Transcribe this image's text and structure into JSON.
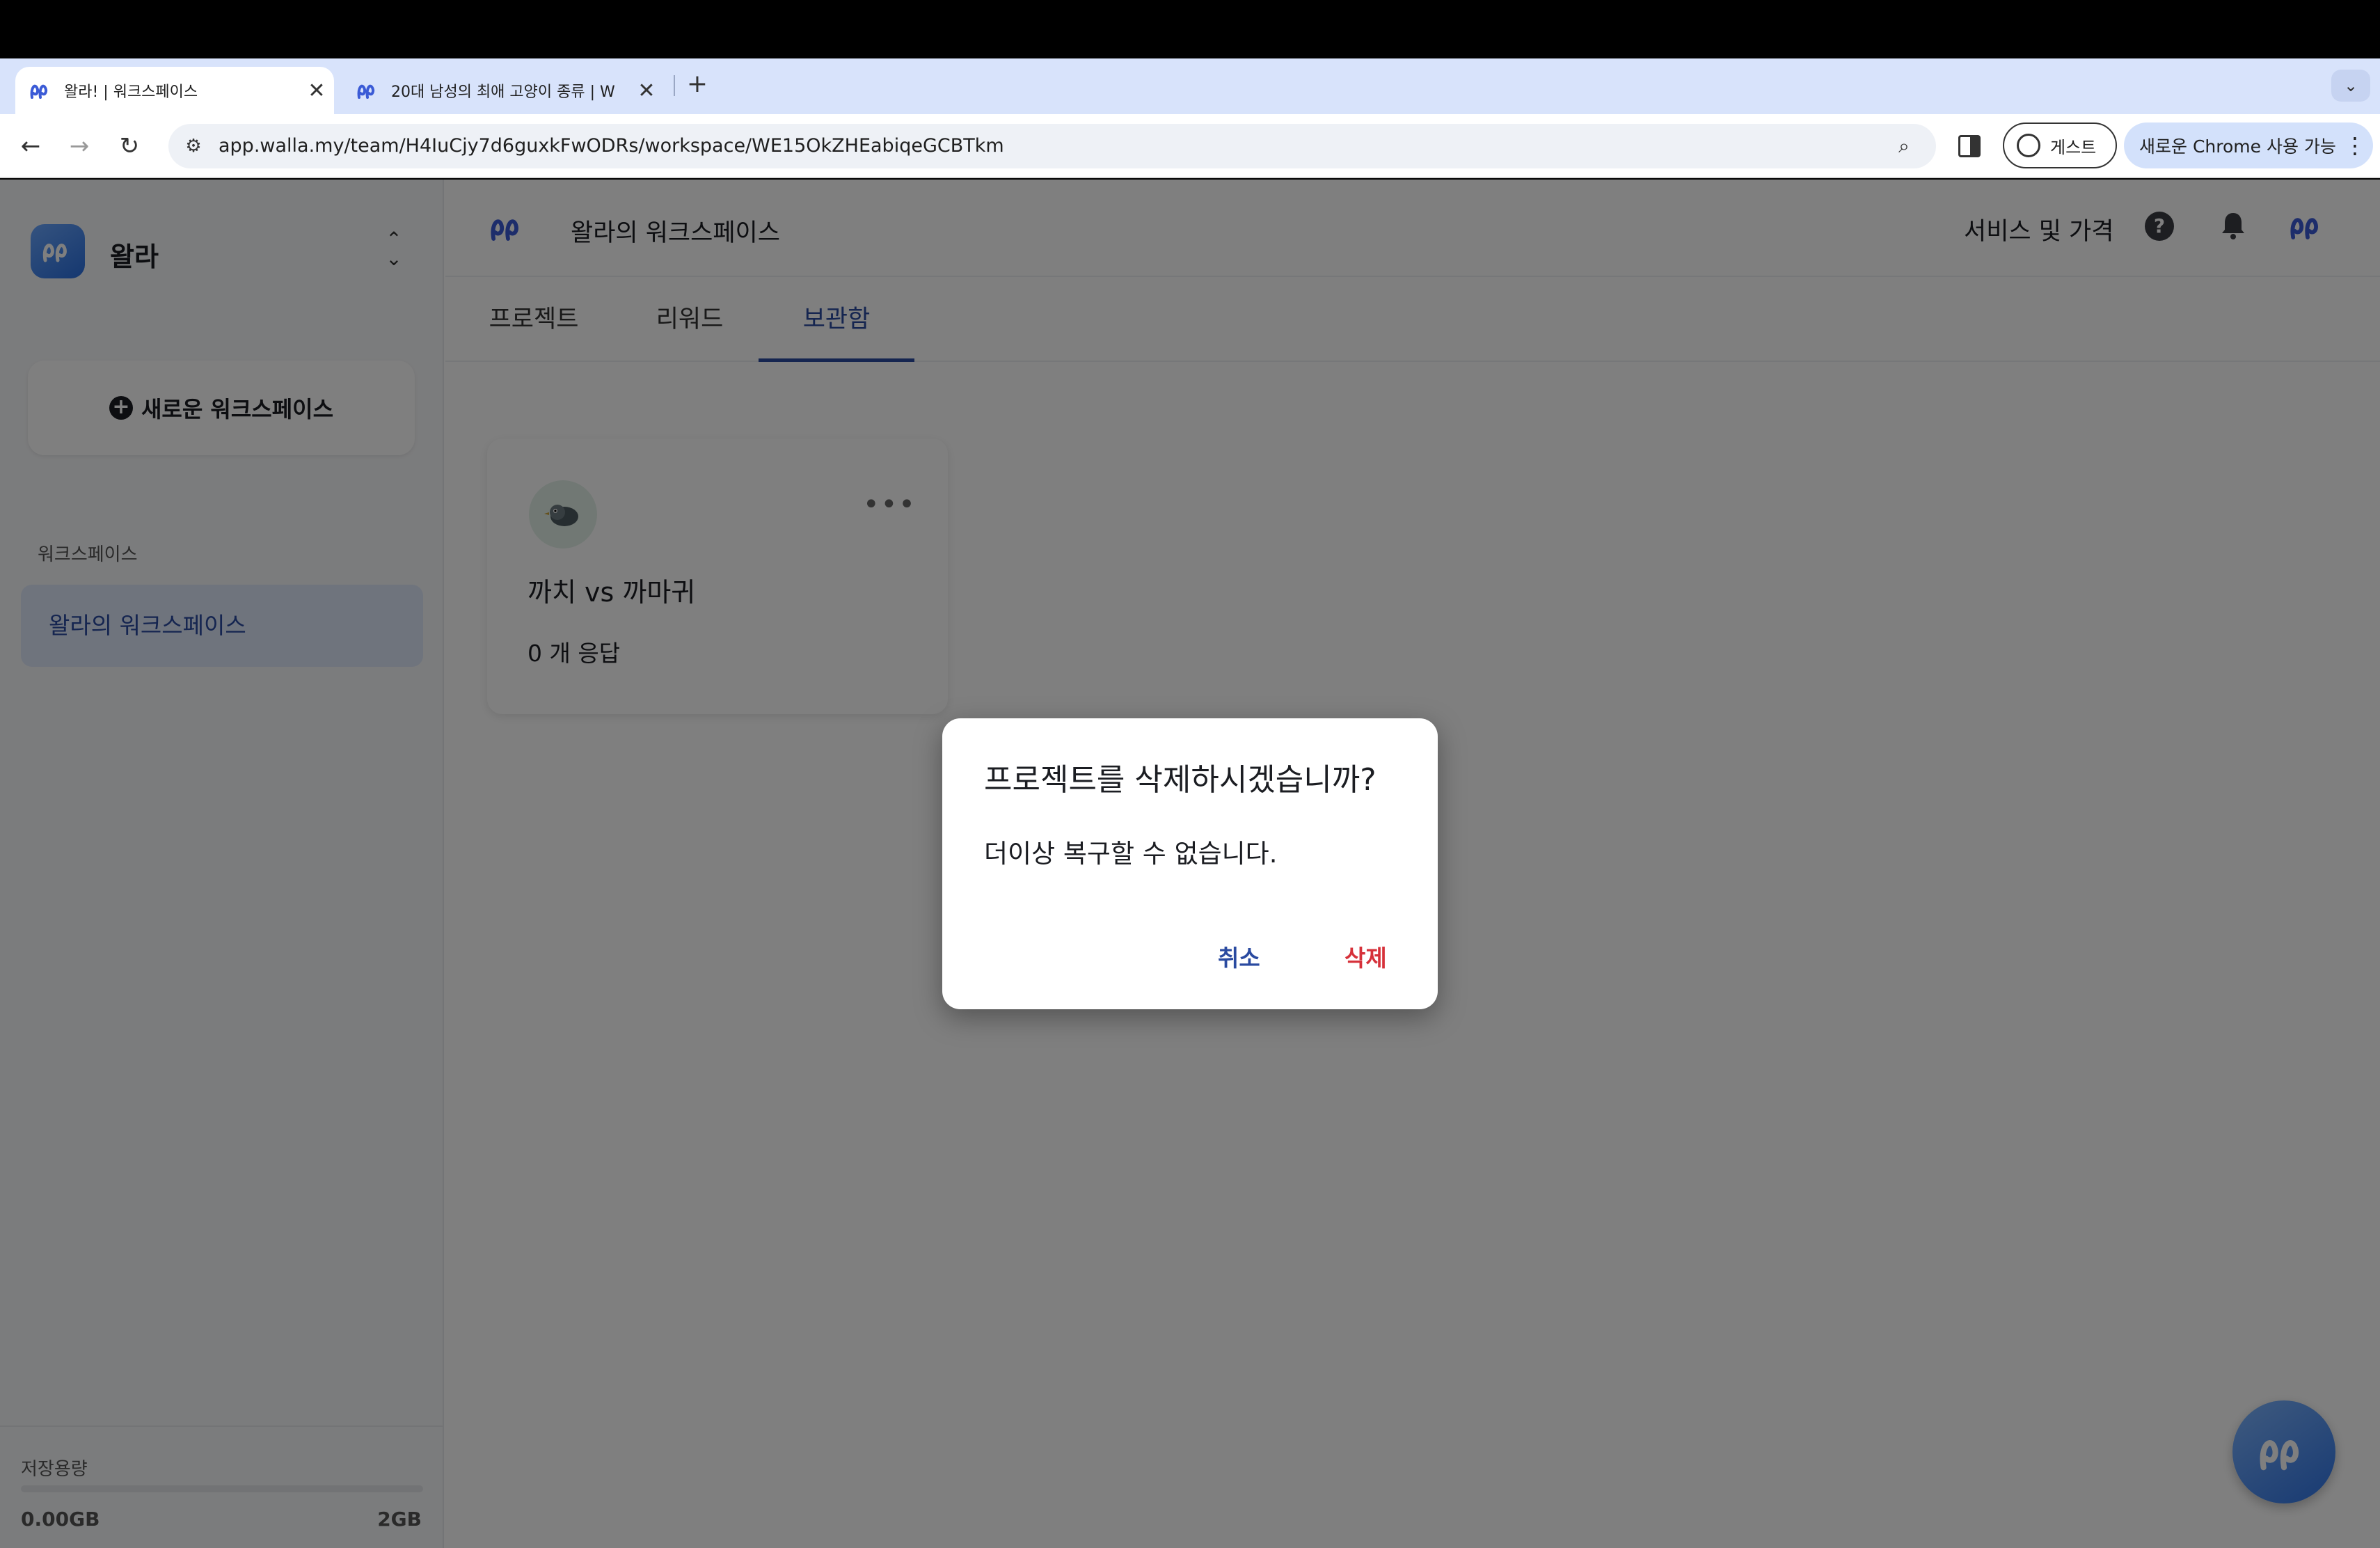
{
  "browser": {
    "tabs": [
      {
        "title": "왈라! | 워크스페이스",
        "close": "✕"
      },
      {
        "title": "20대 남성의 최애 고양이 종류 | W",
        "close": "✕"
      }
    ],
    "new_tab": "+",
    "tab_search": "⌄",
    "url": "app.walla.my/team/H4IuCjy7d6guxkFwODRs/workspace/WE15OkZHEabiqeGCBTkm",
    "guest_label": "게스트",
    "update_label": "새로운 Chrome 사용 가능",
    "menu_icon": "⋮"
  },
  "sidebar": {
    "team_name": "왈라",
    "switch_icon": "⌃⌄",
    "new_workspace_label": "새로운 워크스페이스",
    "section_label": "워크스페이스",
    "workspaces": [
      {
        "label": "왈라의 워크스페이스"
      }
    ],
    "storage": {
      "label": "저장용량",
      "used": "0.00GB",
      "total": "2GB",
      "used_fraction": 0.0
    }
  },
  "header": {
    "title": "왈라의 워크스페이스",
    "link": "서비스 및 가격",
    "help": "?"
  },
  "tabs": [
    {
      "label": "프로젝트"
    },
    {
      "label": "리워드"
    },
    {
      "label": "보관함"
    }
  ],
  "active_tab": "보관함",
  "project_card": {
    "title": "까치 vs 까마귀",
    "responses": "0 개 응답",
    "more": "•••"
  },
  "dialog": {
    "title": "프로젝트를 삭제하시겠습니까?",
    "body": "더이상 복구할 수 없습니다.",
    "cancel": "취소",
    "delete": "삭제"
  },
  "colors": {
    "brand": "#2a4aa0",
    "danger": "#d6313a",
    "tab_bar": "#d8e3fb",
    "overlay": "rgba(0,0,0,0.5)"
  }
}
